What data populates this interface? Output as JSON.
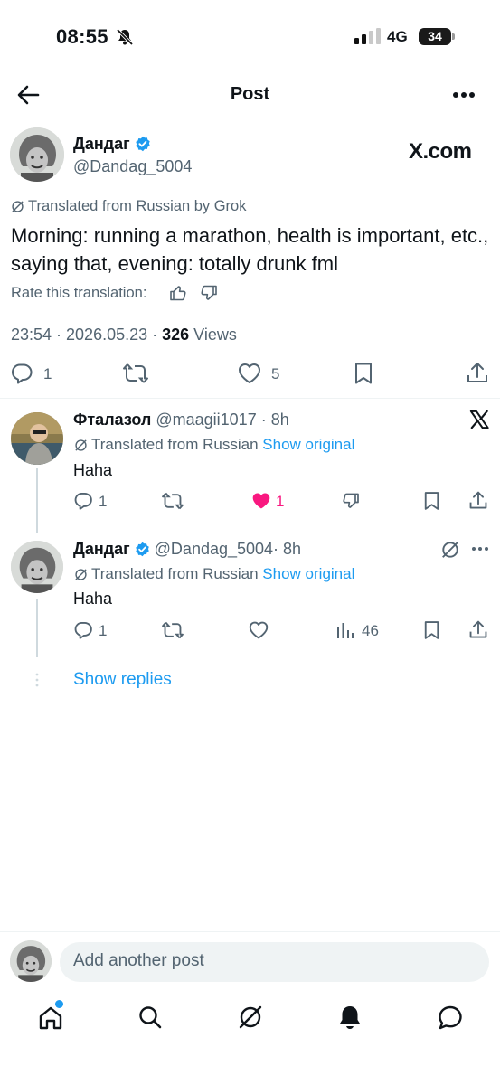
{
  "status_bar": {
    "time": "08:55",
    "network": "4G",
    "battery": "34"
  },
  "header": {
    "title": "Post"
  },
  "post": {
    "author_name": "Дандаг",
    "author_handle": "@Dandag_5004",
    "source_logo": "X.com",
    "translated_note": "Translated from Russian by Grok",
    "text": "Morning: running a marathon, health is important, etc., saying that, evening: totally drunk fml",
    "rate_translation": "Rate this translation:",
    "timestamp": "23:54 · 2026.05.23 · ",
    "views_count": "326",
    "views_label": " Views",
    "reply_count": "1",
    "like_count": "5"
  },
  "replies": [
    {
      "name": "Фталазол",
      "handle": "@maagii1017",
      "time": "· 8h",
      "translated_note": "Translated from Russian",
      "show_original": "Show original",
      "text": "Haha",
      "reply_count": "1",
      "like_count": "1"
    },
    {
      "name": "Дандаг",
      "handle": "@Dandag_5004",
      "time": "· 8h",
      "translated_note": "Translated from Russian",
      "show_original": "Show original",
      "text": "Haha",
      "reply_count": "1",
      "views_count": "46"
    }
  ],
  "show_replies": "Show replies",
  "composer": {
    "placeholder": "Add another post"
  },
  "colors": {
    "accent": "#1d9bf0",
    "like": "#f91880",
    "text": "#0f1419",
    "muted": "#536471"
  },
  "icons": [
    "back-arrow-icon",
    "more-icon",
    "verified-icon",
    "grok-icon",
    "reply-icon",
    "repost-icon",
    "like-icon",
    "bookmark-icon",
    "share-icon",
    "thumbs-up-icon",
    "thumbs-down-icon",
    "views-icon",
    "home-icon",
    "search-icon",
    "grok-nav-icon",
    "notifications-icon",
    "messages-icon"
  ]
}
